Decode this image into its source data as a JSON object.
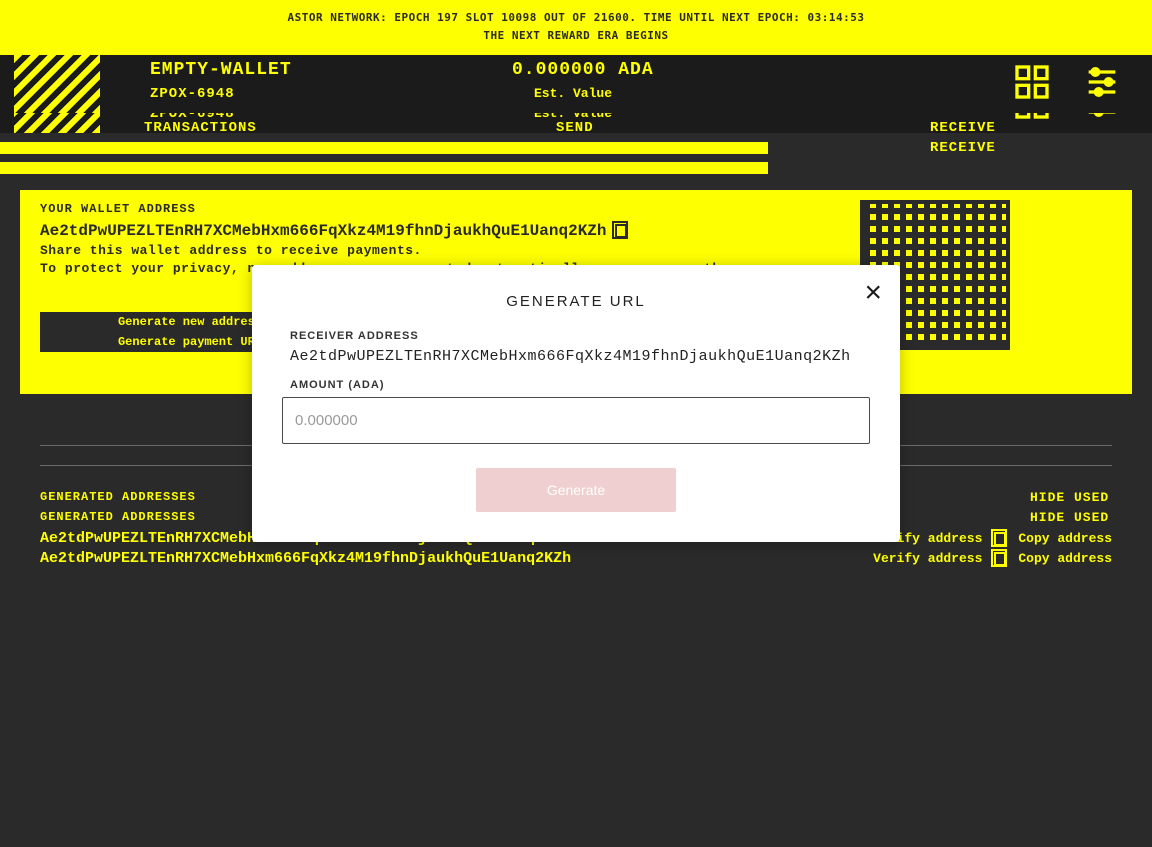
{
  "banner": {
    "line1": "ASTOR NETWORK: EPOCH 197 SLOT 10098 OUT OF 21600. TIME UNTIL NEXT EPOCH: 03:14:53",
    "line2": "THE NEXT REWARD ERA BEGINS"
  },
  "header": {
    "wallet_name": "EMPTY-WALLET",
    "wallet_sub": "ZPOX-6948",
    "balance": "0.000000 ADA",
    "balance_sub": "0.000000 ADA",
    "balance_sub2": "Est. Value"
  },
  "tabs": {
    "transactions": "TRANSACTIONS",
    "send": "SEND",
    "receive": "RECEIVE"
  },
  "panel": {
    "label": "YOUR WALLET ADDRESS",
    "address": "Ae2tdPwUPEZLTEnRH7XCMebHxm666FqXkz4M19fhnDjaukhQuE1Uanq2KZh",
    "share": "Share this wallet address to receive payments.",
    "privacy": "To protect your privacy, new addresses are generated automatically once you use them.",
    "btn1": "Generate new address",
    "btn2": "Generate payment URL"
  },
  "generated": {
    "title": "GENERATED ADDRESSES",
    "hide": "HIDE USED",
    "addr": "Ae2tdPwUPEZLTEnRH7XCMebHxm666FqXkz4M19fhnDjaukhQuE1Uanq2KZh",
    "verify": "Verify address",
    "copy": "Copy address"
  },
  "modal": {
    "title": "GENERATE URL",
    "recv_label": "RECEIVER ADDRESS",
    "recv_addr": "Ae2tdPwUPEZLTEnRH7XCMebHxm666FqXkz4M19fhnDjaukhQuE1Uanq2KZh",
    "amount_label": "AMOUNT (ADA)",
    "amount_placeholder": "0.000000",
    "button": "Generate"
  }
}
